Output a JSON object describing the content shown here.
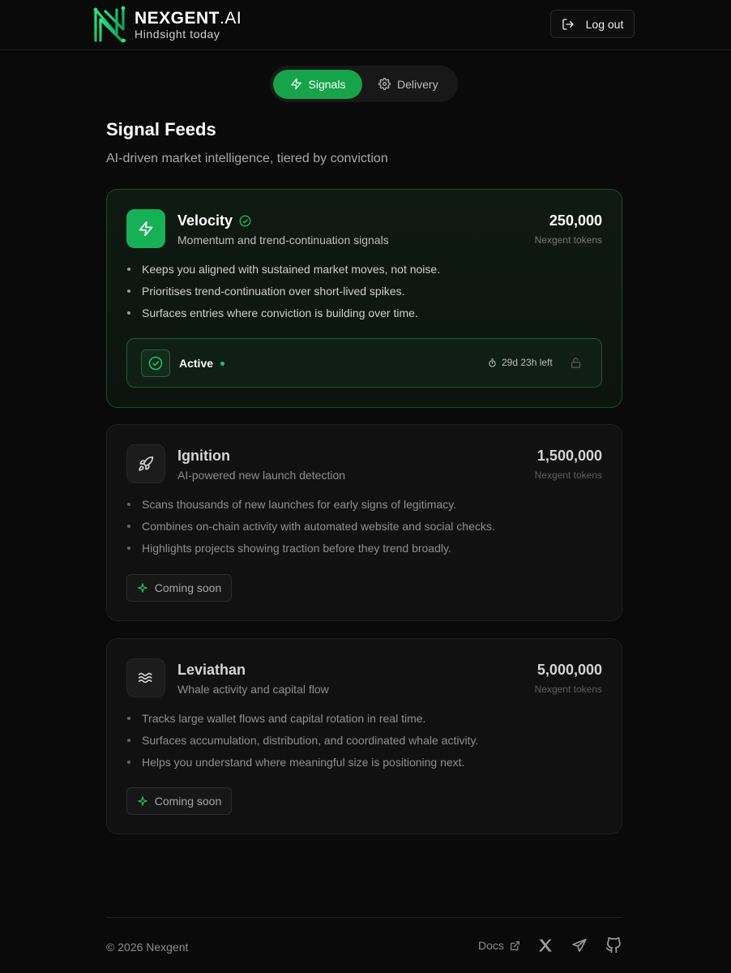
{
  "brand": {
    "name": "NEXGENT",
    "suffix": ".AI",
    "tagline": "Hindsight today",
    "logo_icon": "nexgent-logo-icon",
    "accent": "#16b057"
  },
  "header": {
    "logout_label": "Log out",
    "logout_icon": "log-out-icon"
  },
  "tabs": [
    {
      "label": "Signals",
      "icon": "zap-icon",
      "active": true
    },
    {
      "label": "Delivery",
      "icon": "gear-icon",
      "active": false
    }
  ],
  "page": {
    "title": "Signal Feeds",
    "subtitle": "AI-driven market intelligence, tiered by conviction"
  },
  "feeds": [
    {
      "name": "Velocity",
      "description": "Momentum and trend-continuation signals",
      "price": "250,000",
      "price_unit": "Nexgent tokens",
      "icon": "zap-icon",
      "verified_icon": "check-circle-icon",
      "bullets": [
        "Keeps you aligned with sustained market moves, not noise.",
        "Prioritises trend-continuation over short-lived spikes.",
        "Surfaces entries where conviction is building over time."
      ],
      "status": {
        "label": "Active",
        "time_left": "29d 23h left",
        "timer_icon": "timer-icon",
        "lock_icon": "lock-icon"
      }
    },
    {
      "name": "Ignition",
      "description": "AI-powered new launch detection",
      "price": "1,500,000",
      "price_unit": "Nexgent tokens",
      "icon": "rocket-icon",
      "bullets": [
        "Scans thousands of new launches for early signs of legitimacy.",
        "Combines on-chain activity with automated website and social checks.",
        "Highlights projects showing traction before they trend broadly."
      ],
      "badge": "Coming soon"
    },
    {
      "name": "Leviathan",
      "description": "Whale activity and capital flow",
      "price": "5,000,000",
      "price_unit": "Nexgent tokens",
      "icon": "waves-icon",
      "bullets": [
        "Tracks large wallet flows and capital rotation in real time.",
        "Surfaces accumulation, distribution, and coordinated whale activity.",
        "Helps you understand where meaningful size is positioning next."
      ],
      "badge": "Coming soon"
    }
  ],
  "footer": {
    "copyright": "© 2026 Nexgent",
    "docs_label": "Docs",
    "social_icons": [
      "x-icon",
      "telegram-icon",
      "github-icon"
    ]
  }
}
